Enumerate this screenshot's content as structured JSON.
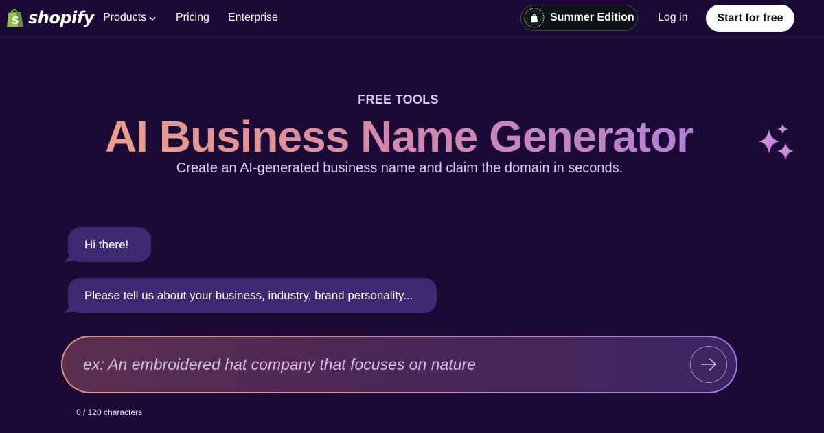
{
  "nav": {
    "brand": "shopify",
    "products_label": "Products",
    "pricing_label": "Pricing",
    "enterprise_label": "Enterprise",
    "summer_label": "Summer Edition",
    "login_label": "Log in",
    "start_label": "Start for free"
  },
  "hero": {
    "eyebrow": "FREE TOOLS",
    "title": "AI Business Name Generator",
    "subtitle": "Create an AI-generated business name and claim the domain in seconds."
  },
  "chat": {
    "messages": [
      "Hi there!",
      "Please tell us about your business, industry, brand personality..."
    ]
  },
  "input": {
    "placeholder": "ex: An embroidered hat company that focuses on nature",
    "value": "",
    "char_count": "0 / 120 characters"
  },
  "colors": {
    "background": "#1b0a36",
    "bubble": "#3d2a72",
    "gradient_start": "#f2a77c",
    "gradient_end": "#a77de6"
  }
}
